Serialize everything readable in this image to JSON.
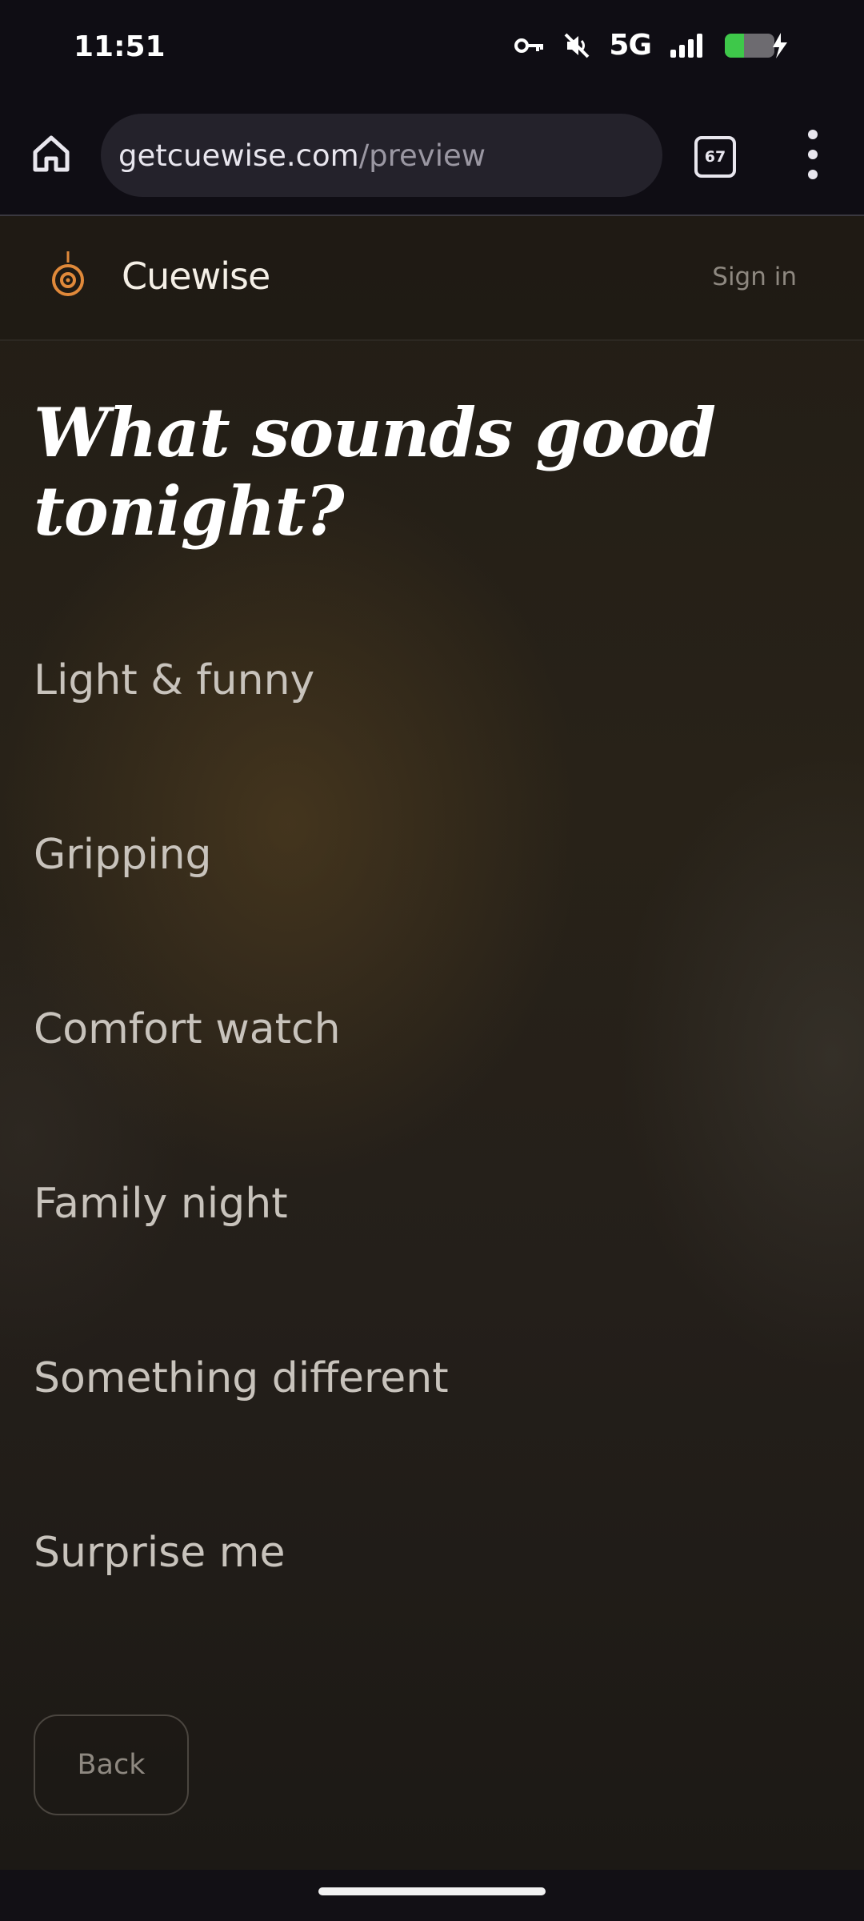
{
  "status_bar": {
    "time": "11:51",
    "network": "5G",
    "icons": [
      "vpn-key-icon",
      "mute-icon",
      "signal-icon",
      "battery-charging-icon"
    ]
  },
  "browser": {
    "url_domain": "getcuewise.com",
    "url_path": "/preview",
    "tab_count": "67"
  },
  "site": {
    "brand": "Cuewise",
    "sign_in_label": "Sign in"
  },
  "main": {
    "headline": "What sounds good tonight?",
    "options": [
      {
        "label": "Light & funny"
      },
      {
        "label": "Gripping"
      },
      {
        "label": "Comfort watch"
      },
      {
        "label": "Family night"
      },
      {
        "label": "Something different"
      },
      {
        "label": "Surprise me"
      }
    ],
    "back_label": "Back"
  },
  "colors": {
    "accent": "#e0893a",
    "background": "#241f1a",
    "text_primary": "#ffffff",
    "text_option": "#c8c3bc"
  }
}
